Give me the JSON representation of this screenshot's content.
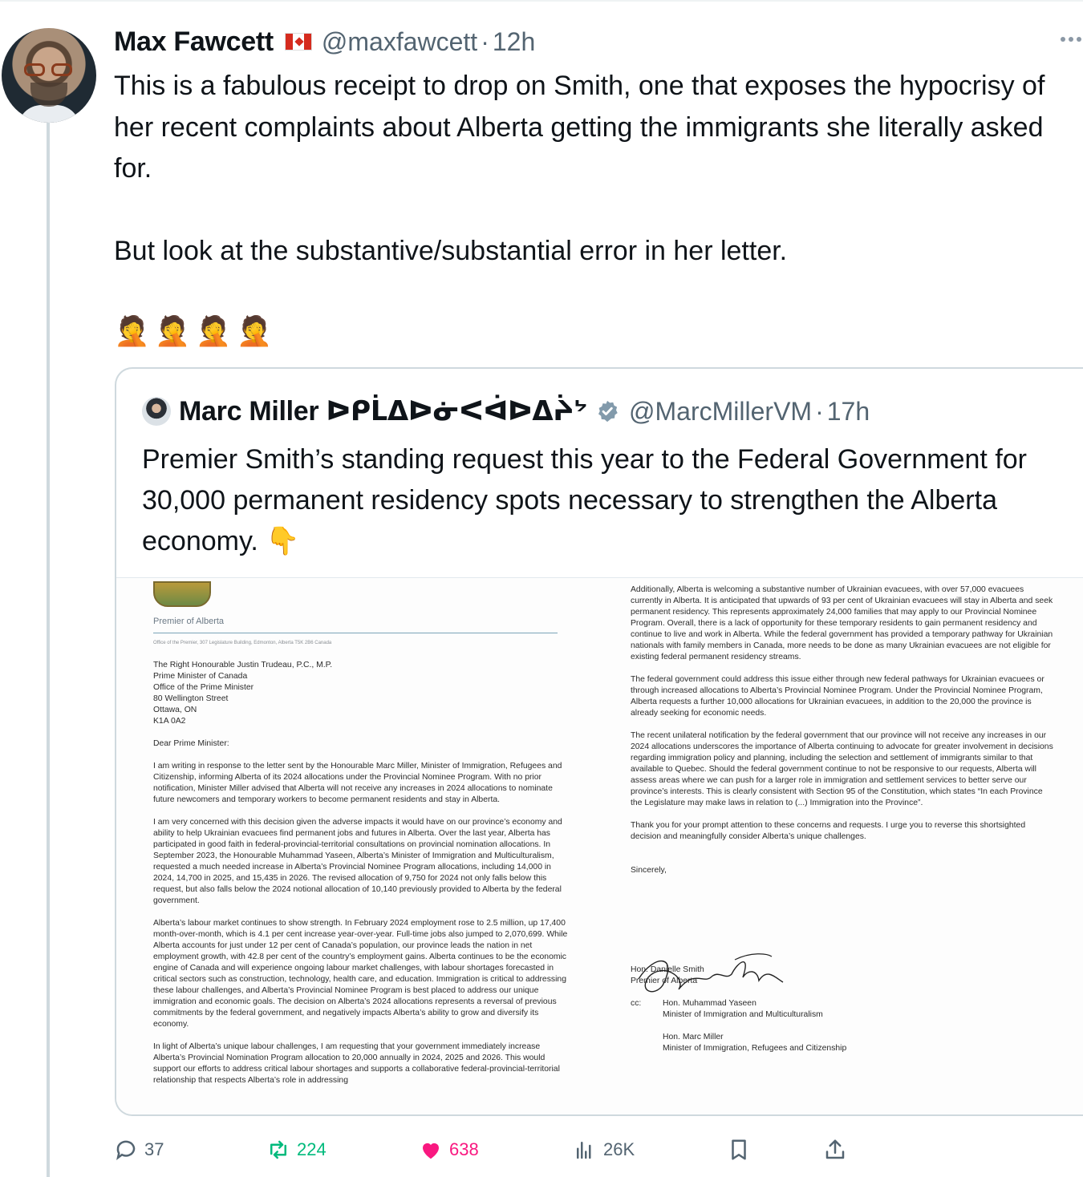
{
  "tweet": {
    "author_name": "Max Fawcett",
    "flag_icon": "canada-flag-icon",
    "handle": "@maxfawcett",
    "separator": "·",
    "time": "12h",
    "text": "This is a fabulous receipt to drop on Smith, one that exposes the hypocrisy of her recent complaints about Alberta getting the immigrants she literally asked for.\n\nBut look at the substantive/substantial error in her letter.",
    "emojis": [
      "🤦",
      "🤦",
      "🤦",
      "🤦"
    ]
  },
  "quote": {
    "author_name": "Marc Miller ᐅᑭᒫᐃᐅᓃᐸᐋᐅᐃᔩᔾ",
    "verified_icon": "verified-badge-icon",
    "handle": "@MarcMillerVM",
    "separator": "·",
    "time": "17h",
    "text": "Premier Smith’s standing request this year to the Federal Government for 30,000 permanent residency spots necessary to strengthen the Alberta economy.",
    "emoji": "👇"
  },
  "letter": {
    "letterhead_title": "Premier of Alberta",
    "letterhead_address": "Office of the Premier, 307 Legislature Building, Edmonton, Alberta  T5K 2B6  Canada",
    "recipient": [
      "The Right Honourable Justin Trudeau, P.C., M.P.",
      "Prime Minister of Canada",
      "Office of the Prime Minister",
      "80 Wellington Street",
      "Ottawa, ON",
      "K1A 0A2"
    ],
    "salutation": "Dear Prime Minister:",
    "left_paragraphs": [
      "I am writing in response to the letter sent by the Honourable Marc Miller, Minister of Immigration, Refugees and Citizenship, informing Alberta of its 2024 allocations under the Provincial Nominee Program. With no prior notification, Minister Miller advised that Alberta will not receive any increases in 2024 allocations to nominate future newcomers and temporary workers to become permanent residents and stay in Alberta.",
      "I am very concerned with this decision given the adverse impacts it would have on our province’s economy and ability to help Ukrainian evacuees find permanent jobs and futures in Alberta. Over the last year, Alberta has participated in good faith in federal-provincial-territorial consultations on provincial nomination allocations. In September 2023, the Honourable Muhammad Yaseen, Alberta’s Minister of Immigration and Multiculturalism, requested a much needed increase in Alberta’s Provincial Nominee Program allocations, including 14,000 in 2024, 14,700 in 2025, and 15,435 in 2026. The revised allocation of 9,750 for 2024 not only falls below this request, but also falls below the 2024 notional allocation of 10,140 previously provided to Alberta by the federal government.",
      "Alberta’s labour market continues to show strength. In February 2024 employment rose to 2.5 million, up 17,400 month-over-month, which is 4.1 per cent increase year-over-year. Full-time jobs also jumped to 2,070,699. While Alberta accounts for just under 12 per cent of Canada’s population, our province leads the nation in net employment growth, with 42.8 per cent of the country’s employment gains. Alberta continues to be the economic engine of Canada and will experience ongoing labour market challenges, with labour shortages forecasted in critical sectors such as construction, technology, health care, and education. Immigration is critical to addressing these labour challenges, and Alberta’s Provincial Nominee Program is best placed to address our unique immigration and economic goals. The decision on Alberta’s 2024 allocations represents a reversal of previous commitments by the federal government, and negatively impacts Alberta’s ability to grow and diversify its economy.",
      "In light of Alberta’s unique labour challenges, I am requesting that your government immediately increase Alberta’s Provincial Nomination Program allocation to 20,000 annually in 2024, 2025 and 2026. This would support our efforts to address critical labour shortages and supports a collaborative federal-provincial-territorial relationship that respects Alberta’s role in addressing"
    ],
    "right_paragraphs": [
      "Additionally, Alberta is welcoming a substantive number of Ukrainian evacuees, with over 57,000 evacuees currently in Alberta. It is anticipated that upwards of 93 per cent of Ukrainian evacuees will stay in Alberta and seek permanent residency. This represents approximately 24,000 families that may apply to our Provincial Nominee Program. Overall, there is a lack of opportunity for these temporary residents to gain permanent residency and continue to live and work in Alberta. While the federal government has provided a temporary pathway for Ukrainian nationals with family members in Canada, more needs to be done as many Ukrainian evacuees are not eligible for existing federal permanent residency streams.",
      "The federal government could address this issue either through new federal pathways for Ukrainian evacuees or through increased allocations to Alberta’s Provincial Nominee Program. Under the Provincial Nominee Program, Alberta requests a further 10,000 allocations for Ukrainian evacuees, in addition to the 20,000 the province is already seeking for economic needs.",
      "The recent unilateral notification by the federal government that our province will not receive any increases in our 2024 allocations underscores the importance of Alberta continuing to advocate for greater involvement in decisions regarding immigration policy and planning, including the selection and settlement of immigrants similar to that available to Quebec. Should the federal government continue to not be responsive to our requests, Alberta will assess areas where we can push for a larger role in immigration and settlement services to better serve our province’s interests. This is clearly consistent with Section 95 of the Constitution, which states “In each Province the Legislature may make laws in relation to (...) Immigration into the Province”.",
      "Thank you for your prompt attention to these concerns and requests. I urge you to reverse this shortsighted decision and meaningfully consider Alberta’s unique challenges."
    ],
    "closing": "Sincerely,",
    "signature_icon": "handwritten-signature",
    "signer_name": "Hon. Danielle Smith",
    "signer_title": "Premier of Alberta",
    "cc_label": "cc:",
    "cc": [
      {
        "name": "Hon. Muhammad Yaseen",
        "title": "Minister of Immigration and Multiculturalism"
      },
      {
        "name": "Hon. Marc Miller",
        "title": "Minister of Immigration, Refugees and Citizenship"
      }
    ]
  },
  "actions": {
    "replies": "37",
    "reposts": "224",
    "likes": "638",
    "views": "26K",
    "colors": {
      "repost": "#00ba7c",
      "like": "#f91880",
      "muted": "#536471"
    }
  }
}
